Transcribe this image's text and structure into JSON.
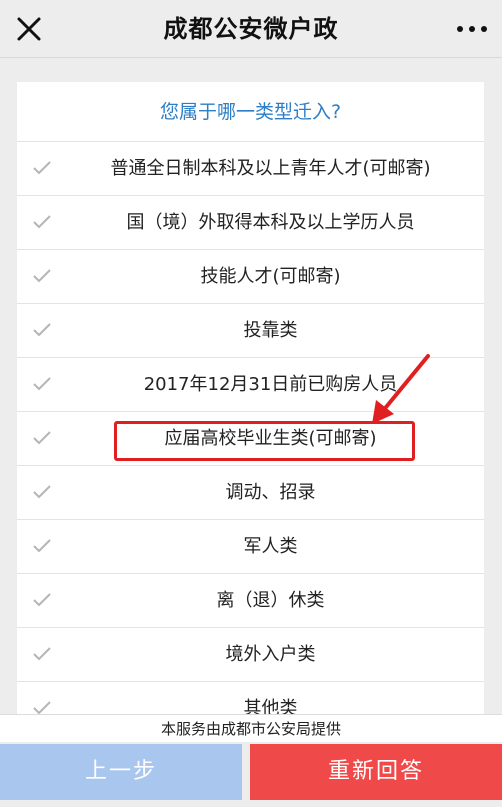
{
  "nav": {
    "title": "成都公安微户政",
    "close_icon": "close-icon",
    "more_icon": "more-icon"
  },
  "question": {
    "title": "您属于哪一类型迁入?"
  },
  "options": [
    {
      "label": "普通全日制本科及以上青年人才(可邮寄)"
    },
    {
      "label": "国（境）外取得本科及以上学历人员"
    },
    {
      "label": "技能人才(可邮寄)"
    },
    {
      "label": "投靠类"
    },
    {
      "label": "2017年12月31日前已购房人员"
    },
    {
      "label": "应届高校毕业生类(可邮寄)"
    },
    {
      "label": "调动、招录"
    },
    {
      "label": "军人类"
    },
    {
      "label": "离（退）休类"
    },
    {
      "label": "境外入户类"
    },
    {
      "label": "其他类"
    }
  ],
  "footer": {
    "note": "本服务由成都市公安局提供",
    "prev_label": "上一步",
    "restart_label": "重新回答"
  },
  "colors": {
    "accent_blue": "#2c7ec6",
    "prev_button": "#a9c6ee",
    "restart_button": "#ef4949",
    "annotation_red": "#e02020"
  }
}
